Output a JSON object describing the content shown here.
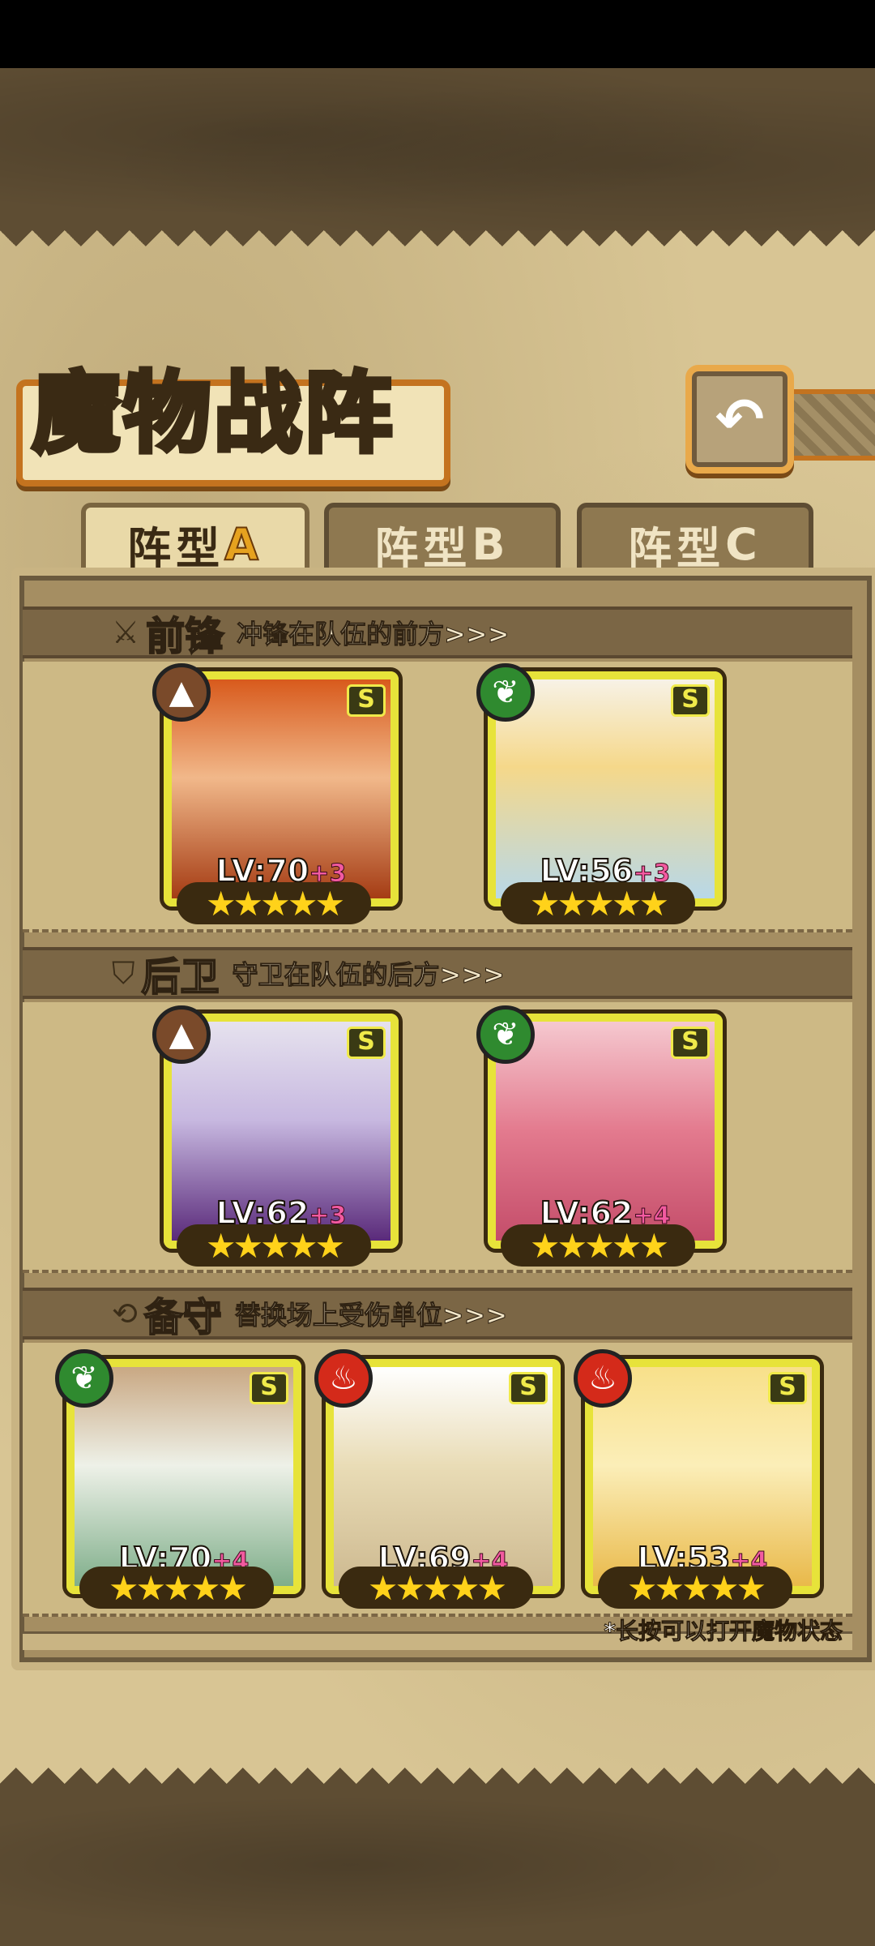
{
  "title": "魔物战阵",
  "back_icon": "back-arrow-icon",
  "tabs": [
    {
      "prefix": "阵型",
      "letter": "A",
      "active": true
    },
    {
      "prefix": "阵型",
      "letter": "B",
      "active": false
    },
    {
      "prefix": "阵型",
      "letter": "C",
      "active": false
    }
  ],
  "sections": {
    "front": {
      "icon": "sword-icon",
      "title": "前锋",
      "desc": "冲锋在队伍的前方>>>"
    },
    "back": {
      "icon": "shield-icon",
      "title": "后卫",
      "desc": "守卫在队伍的后方>>>"
    },
    "reserve": {
      "icon": "swap-icon",
      "title": "备守",
      "desc": "替换场上受伤单位>>>"
    }
  },
  "rank_label": "S",
  "stars_text": "★★★★★",
  "cards": {
    "front1": {
      "element": "earth",
      "level": "LV:70",
      "plus": "+3",
      "stars": 5
    },
    "front2": {
      "element": "leaf",
      "level": "LV:56",
      "plus": "+3",
      "stars": 5
    },
    "back1": {
      "element": "earth",
      "level": "LV:62",
      "plus": "+3",
      "stars": 5
    },
    "back2": {
      "element": "leaf",
      "level": "LV:62",
      "plus": "+4",
      "stars": 5
    },
    "res1": {
      "element": "leaf",
      "level": "LV:70",
      "plus": "+4",
      "stars": 5
    },
    "res2": {
      "element": "fire",
      "level": "LV:69",
      "plus": "+4",
      "stars": 5
    },
    "res3": {
      "element": "fire",
      "level": "LV:53",
      "plus": "+4",
      "stars": 5
    }
  },
  "hint": "*长按可以打开魔物状态",
  "colors": {
    "card_border": "#e7e33a",
    "star": "#ffd21a",
    "plus": "#f25aa0"
  }
}
